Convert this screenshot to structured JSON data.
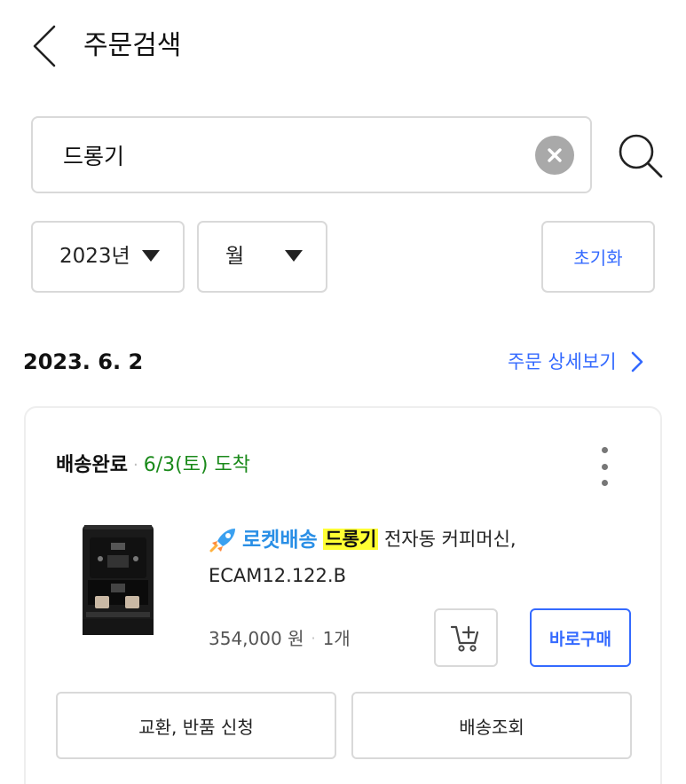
{
  "header": {
    "title": "주문검색",
    "back_icon": "chevron-left-icon"
  },
  "search": {
    "value": "드롱기",
    "clear_icon": "close-circle-icon",
    "search_icon": "magnifier-icon"
  },
  "filters": {
    "year": "2023년",
    "month": "월",
    "reset_label": "초기화"
  },
  "order": {
    "date": "2023. 6. 2",
    "detail_link": "주문 상세보기",
    "status": "배송완료",
    "arrival": "6/3(토) 도착",
    "product": {
      "badge": "로켓배송",
      "brand_highlight": "드롱기",
      "name_rest": "전자동 커피머신,",
      "model": "ECAM12.122.B",
      "price": "354,000 원",
      "quantity": "1개"
    },
    "buy_now_label": "바로구매",
    "exchange_label": "교환, 반품 신청",
    "tracking_label": "배송조회"
  },
  "colors": {
    "accent": "#346aff",
    "arrival_green": "#1b8a1b",
    "highlight": "#ffff33",
    "rocket_blue": "#2a8fe6"
  }
}
